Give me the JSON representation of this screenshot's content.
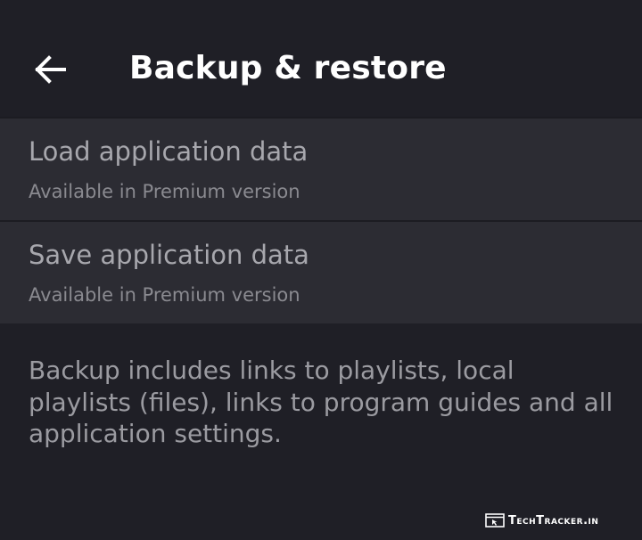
{
  "header": {
    "back_icon": "arrow-left-icon",
    "title": "Backup & restore"
  },
  "settings": {
    "items": [
      {
        "title": "Load application data",
        "subtitle": "Available in Premium version"
      },
      {
        "title": "Save application data",
        "subtitle": "Available in Premium version"
      }
    ]
  },
  "info": {
    "text": "Backup includes links to playlists, local playlists (files), links to program guides and all application settings."
  },
  "watermark": {
    "text": "TechTracker.in"
  },
  "colors": {
    "background": "#1f1f26",
    "item_background": "#2c2c33",
    "title_text": "#ffffff",
    "item_title_text": "#a7a7ad",
    "item_subtitle_text": "#8a8a90",
    "info_text": "#9b9ba1"
  }
}
